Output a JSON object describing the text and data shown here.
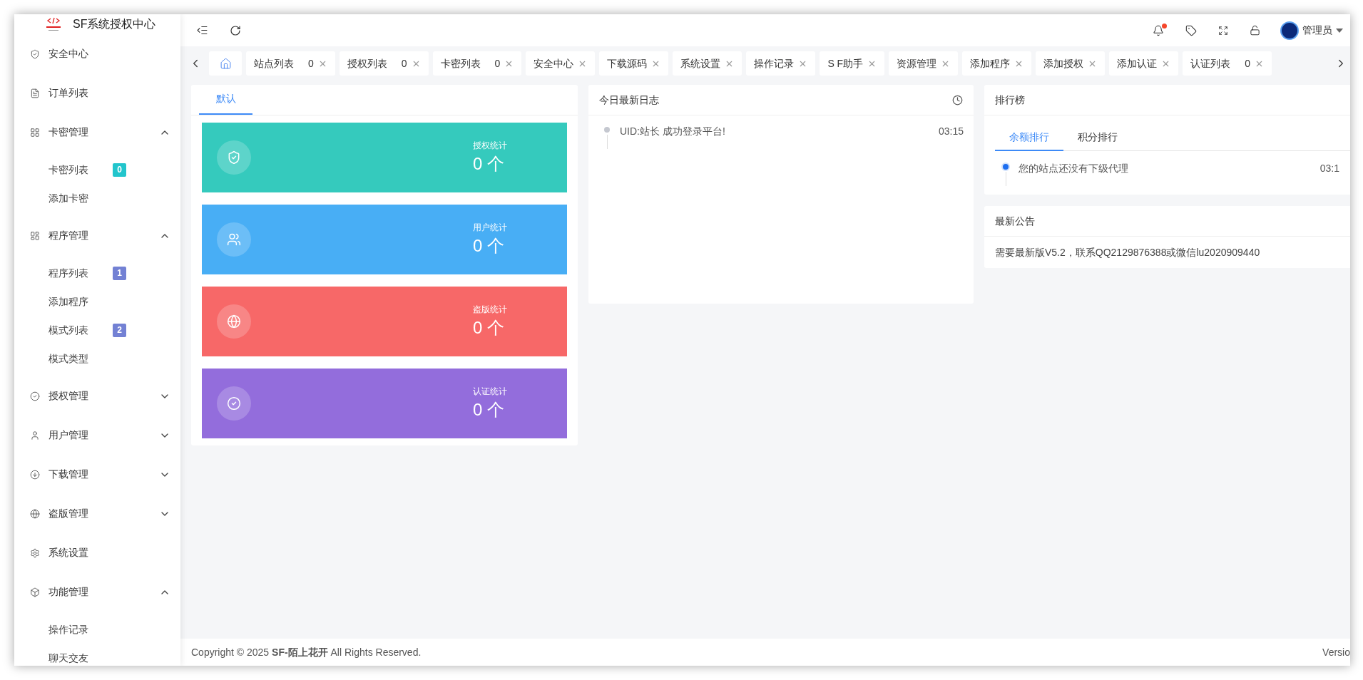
{
  "sidebar": {
    "title": "SF系统授权中心",
    "items": [
      {
        "label": "安全中心"
      },
      {
        "label": "订单列表"
      },
      {
        "label": "卡密管理",
        "expanded": true,
        "children": [
          {
            "label": "卡密列表",
            "badge": "0",
            "color": "#22c5cc"
          },
          {
            "label": "添加卡密"
          }
        ]
      },
      {
        "label": "程序管理",
        "expanded": true,
        "children": [
          {
            "label": "程序列表",
            "badge": "1",
            "color": "#7381d4"
          },
          {
            "label": "添加程序"
          },
          {
            "label": "模式列表",
            "badge": "2",
            "color": "#7381d4"
          },
          {
            "label": "模式类型"
          }
        ]
      },
      {
        "label": "授权管理",
        "expanded": false
      },
      {
        "label": "用户管理",
        "expanded": false
      },
      {
        "label": "下载管理",
        "expanded": false
      },
      {
        "label": "盗版管理",
        "expanded": false
      },
      {
        "label": "系统设置"
      },
      {
        "label": "功能管理",
        "expanded": true,
        "children": [
          {
            "label": "操作记录"
          },
          {
            "label": "聊天交友"
          }
        ]
      }
    ]
  },
  "header": {
    "notification": true,
    "user": "管理员"
  },
  "tabs": [
    {
      "kind": "home",
      "selected": true
    },
    {
      "kind": "page",
      "label": "站点列表",
      "count": "0",
      "selected": false
    },
    {
      "kind": "page",
      "label": "授权列表",
      "count": "0",
      "selected": false
    },
    {
      "kind": "page",
      "label": "卡密列表",
      "count": "0",
      "selected": false
    },
    {
      "kind": "page",
      "label": "安全中心",
      "selected": false
    },
    {
      "kind": "page",
      "label": "下载源码",
      "selected": false
    },
    {
      "kind": "page",
      "label": "系统设置",
      "selected": false
    },
    {
      "kind": "page",
      "label": "操作记录",
      "selected": false
    },
    {
      "kind": "page",
      "label": "S F助手",
      "selected": false
    },
    {
      "kind": "page",
      "label": "资源管理",
      "selected": false
    },
    {
      "kind": "page",
      "label": "添加程序",
      "selected": false
    },
    {
      "kind": "page",
      "label": "添加授权",
      "selected": false
    },
    {
      "kind": "page",
      "label": "添加认证",
      "selected": false
    },
    {
      "kind": "page",
      "label": "认证列表",
      "count": "0",
      "selected": false
    }
  ],
  "stats": {
    "tabs": [
      {
        "label": "默认",
        "selected": true
      }
    ],
    "cards": [
      {
        "kind": "shield",
        "label": "授权统计",
        "value": "0 个",
        "color": "#35cabd"
      },
      {
        "kind": "users",
        "label": "用户统计",
        "value": "0 个",
        "color": "#48aef5"
      },
      {
        "kind": "globe",
        "label": "盗版统计",
        "value": "0 个",
        "color": "#f76868"
      },
      {
        "kind": "check",
        "label": "认证统计",
        "value": "0 个",
        "color": "#936ddc"
      }
    ]
  },
  "log": {
    "title": "今日最新日志",
    "entries": [
      {
        "text": "UID:站长 成功登录平台!",
        "time": "03:15"
      }
    ]
  },
  "ranking": {
    "title": "排行榜",
    "tabs": [
      {
        "label": "余额排行",
        "selected": true
      },
      {
        "label": "积分排行",
        "selected": false
      }
    ],
    "entries": [
      {
        "text": "您的站点还没有下级代理",
        "time": "03:1"
      }
    ]
  },
  "notice": {
    "title": "最新公告",
    "text": "需要最新版V5.2，联系QQ2129876388或微信lu2020909440"
  },
  "footer": {
    "copyright": "Copyright © 2025 **SF-陌上花开** All Rights Reserved.",
    "version": "Versio"
  }
}
